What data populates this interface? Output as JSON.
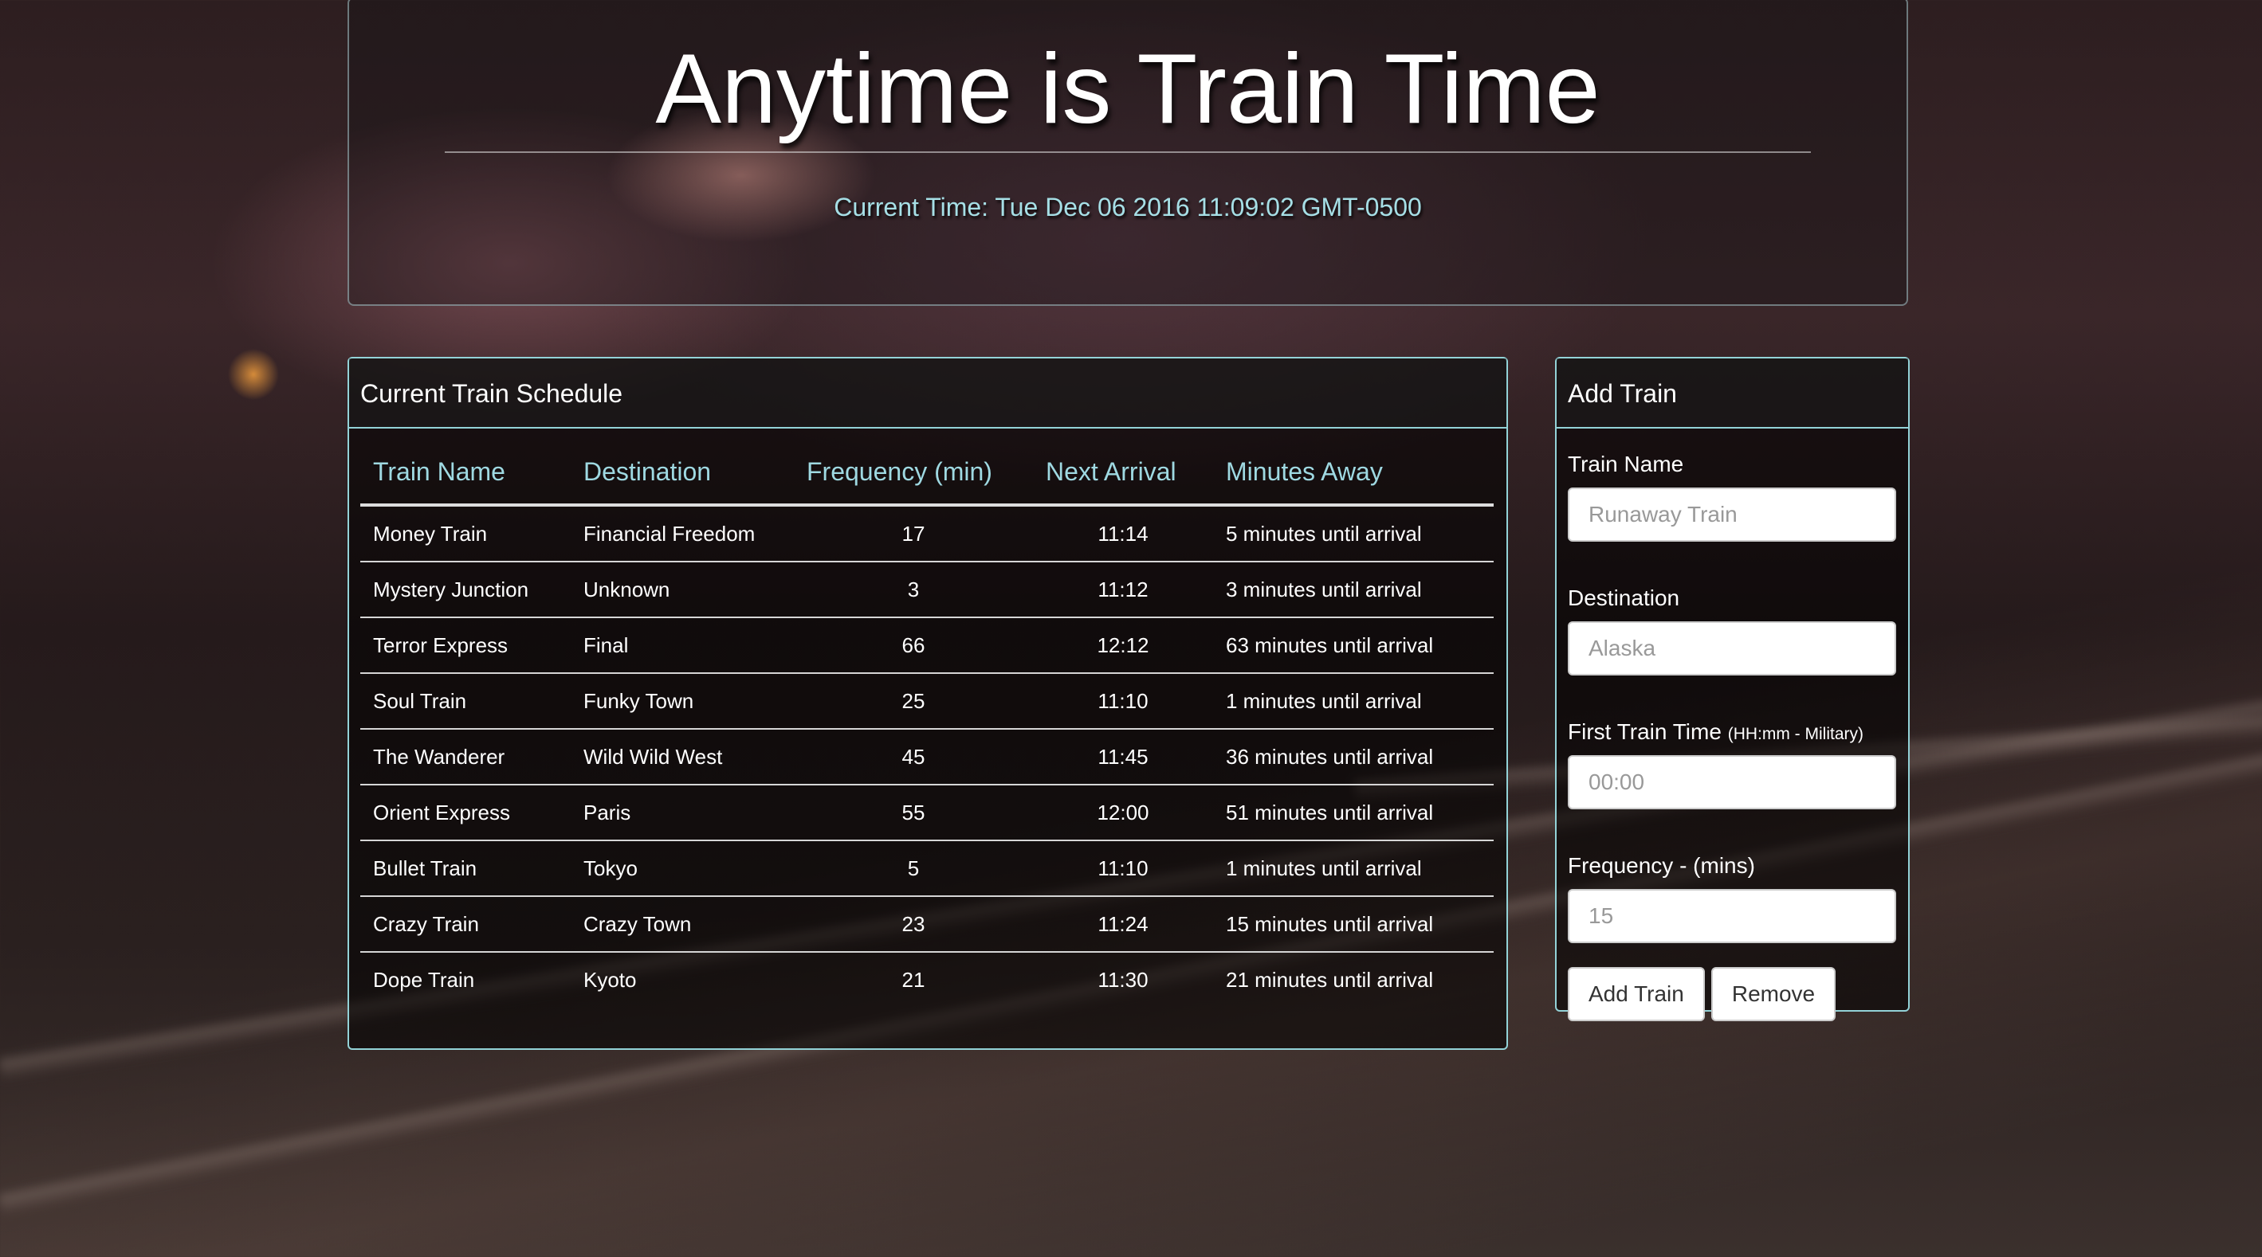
{
  "header": {
    "title": "Anytime is Train Time",
    "current_time": "Current Time: Tue Dec 06 2016 11:09:02 GMT-0500"
  },
  "schedule": {
    "heading": "Current Train Schedule",
    "columns": [
      "Train Name",
      "Destination",
      "Frequency (min)",
      "Next Arrival",
      "Minutes Away"
    ],
    "rows": [
      [
        "Money Train",
        "Financial Freedom",
        "17",
        "11:14",
        "5 minutes until arrival"
      ],
      [
        "Mystery Junction",
        "Unknown",
        "3",
        "11:12",
        "3 minutes until arrival"
      ],
      [
        "Terror Express",
        "Final",
        "66",
        "12:12",
        "63 minutes until arrival"
      ],
      [
        "Soul Train",
        "Funky Town",
        "25",
        "11:10",
        "1 minutes until arrival"
      ],
      [
        "The Wanderer",
        "Wild Wild West",
        "45",
        "11:45",
        "36 minutes until arrival"
      ],
      [
        "Orient Express",
        "Paris",
        "55",
        "12:00",
        "51 minutes until arrival"
      ],
      [
        "Bullet Train",
        "Tokyo",
        "5",
        "11:10",
        "1 minutes until arrival"
      ],
      [
        "Crazy Train",
        "Crazy Town",
        "23",
        "11:24",
        "15 minutes until arrival"
      ],
      [
        "Dope Train",
        "Kyoto",
        "21",
        "11:30",
        "21 minutes until arrival"
      ]
    ]
  },
  "add_train": {
    "heading": "Add Train",
    "train_name": {
      "label": "Train Name",
      "placeholder": "Runaway Train"
    },
    "destination": {
      "label": "Destination",
      "placeholder": "Alaska"
    },
    "first_train_time": {
      "label": "First Train Time",
      "hint": "(HH:mm - Military)",
      "placeholder": "00:00"
    },
    "frequency": {
      "label": "Frequency - (mins)",
      "placeholder": "15"
    },
    "add_button": "Add Train",
    "remove_button": "Remove"
  }
}
